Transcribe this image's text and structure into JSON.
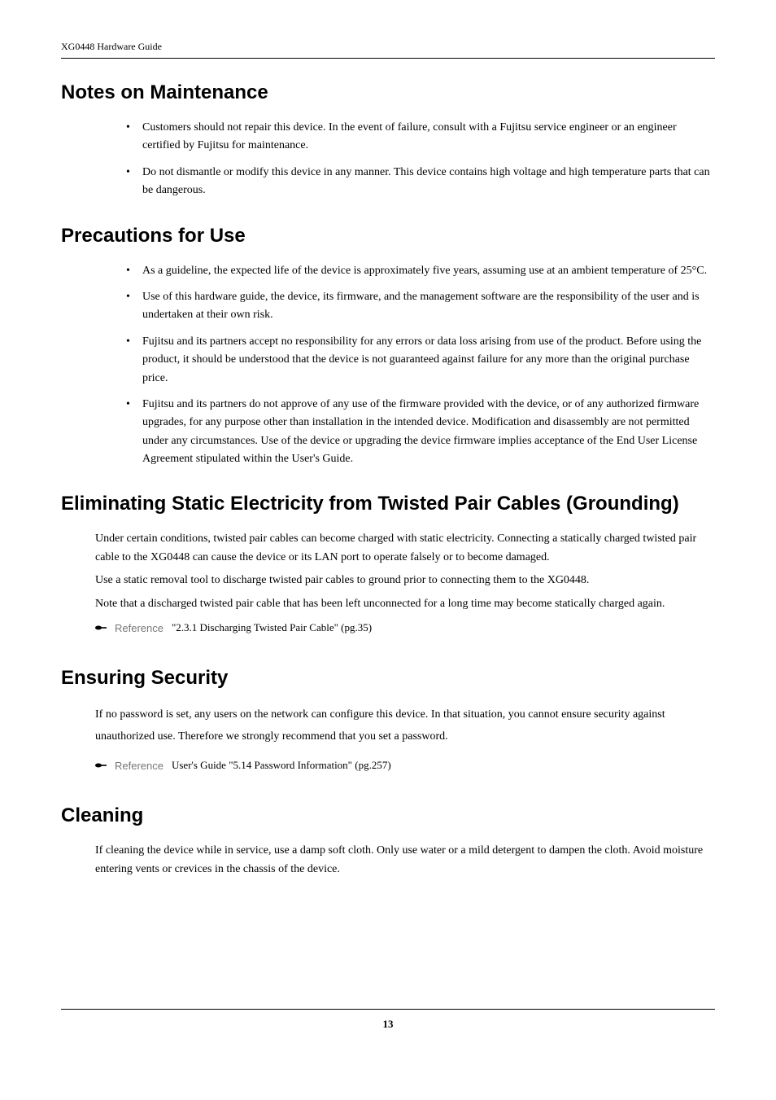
{
  "header": {
    "doc_title": "XG0448 Hardware Guide"
  },
  "sections": {
    "notes_on_maintenance": {
      "heading": "Notes on Maintenance",
      "items": [
        "Customers should not repair this device. In the event of failure, consult with a Fujitsu service engineer or an engineer certified by Fujitsu for maintenance.",
        "Do not dismantle or modify this device in any manner. This device contains high voltage and high temperature parts that can be dangerous."
      ]
    },
    "precautions_for_use": {
      "heading": "Precautions for Use",
      "items": [
        "As a guideline, the expected life of the device is approximately five years, assuming use at an ambient temperature of 25°C.",
        "Use of this hardware guide, the device, its firmware, and the management software are the responsibility of the user and is undertaken at their own risk.",
        "Fujitsu and its partners accept no responsibility for any errors or data loss arising from use of the product. Before using the product, it should be understood that the device is not guaranteed against failure for any more than the original purchase price.",
        "Fujitsu and its partners do not approve of any use of the firmware provided with the device, or of any authorized firmware upgrades, for any purpose other than installation in the intended device. Modification and disassembly are not permitted under any circumstances. Use of the device or upgrading the device firmware implies acceptance of the End User License Agreement stipulated within the User's Guide."
      ]
    },
    "eliminating_static": {
      "heading": "Eliminating Static Electricity from Twisted Pair Cables (Grounding)",
      "paras": [
        "Under certain conditions, twisted pair cables can become charged with static electricity. Connecting a statically charged twisted pair cable to the XG0448 can cause the device or its LAN port to operate falsely or to become damaged.",
        "Use a static removal tool to discharge twisted pair cables to ground prior to connecting them to the XG0448.",
        "Note that a discharged twisted pair cable that has been left unconnected for a long time may become statically charged again."
      ],
      "reference": {
        "label": "Reference",
        "text": "\"2.3.1 Discharging Twisted Pair Cable\" (pg.35)"
      }
    },
    "ensuring_security": {
      "heading": "Ensuring Security",
      "para": "If no password is set, any users on the network can configure this device. In that situation, you cannot ensure security against unauthorized use. Therefore we strongly recommend that you set a password.",
      "reference": {
        "label": "Reference",
        "text": "User's Guide \"5.14 Password Information\" (pg.257)"
      }
    },
    "cleaning": {
      "heading": "Cleaning",
      "para": "If cleaning the device while in service, use a damp soft cloth. Only use water or a mild detergent to dampen the cloth. Avoid moisture entering vents or crevices in the chassis of the device."
    }
  },
  "footer": {
    "page_number": "13"
  }
}
